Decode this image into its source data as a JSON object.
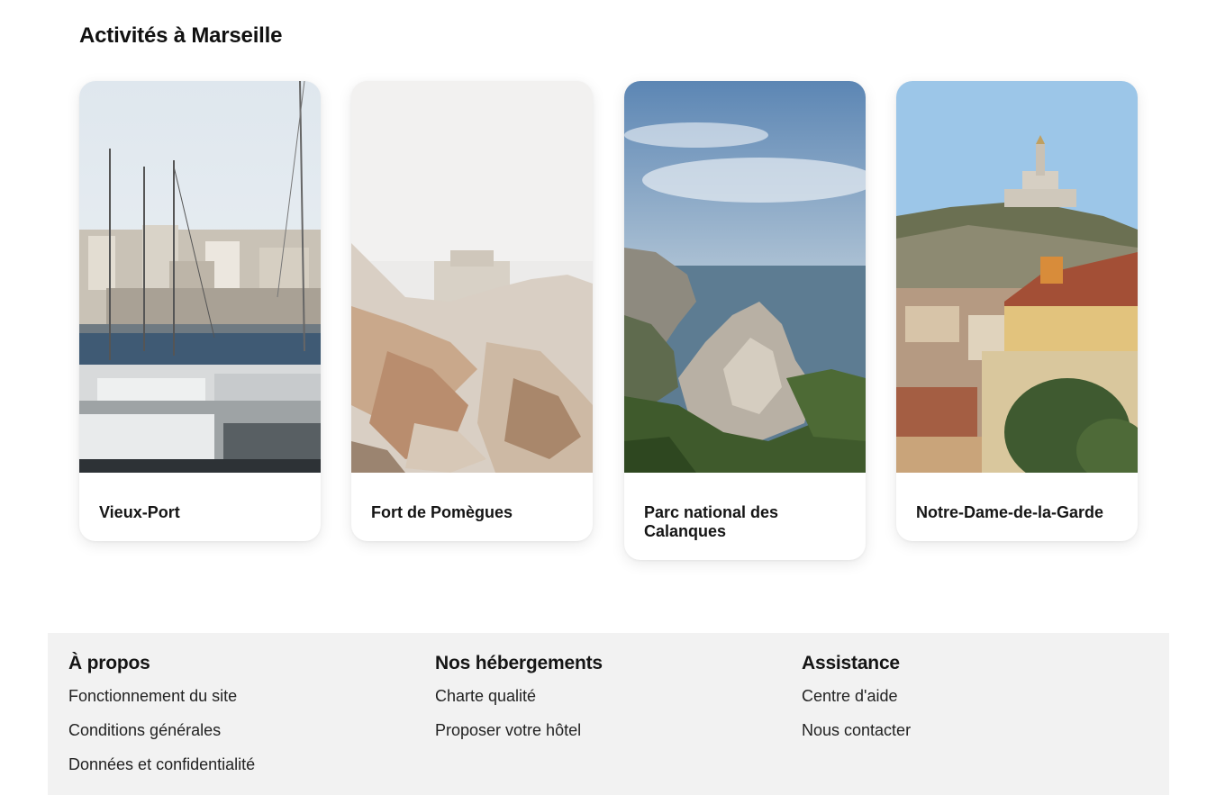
{
  "section": {
    "title": "Activités à Marseille"
  },
  "cards": [
    {
      "label": "Vieux-Port"
    },
    {
      "label": "Fort de Pomègues"
    },
    {
      "label": "Parc national des Calanques"
    },
    {
      "label": "Notre-Dame-de-la-Garde"
    }
  ],
  "footer": {
    "columns": [
      {
        "title": "À propos",
        "links": [
          "Fonctionnement du site",
          "Conditions générales",
          "Données et confidentialité"
        ]
      },
      {
        "title": "Nos hébergements",
        "links": [
          "Charte qualité",
          "Proposer votre hôtel"
        ]
      },
      {
        "title": "Assistance",
        "links": [
          "Centre d'aide",
          "Nous contacter"
        ]
      }
    ]
  }
}
